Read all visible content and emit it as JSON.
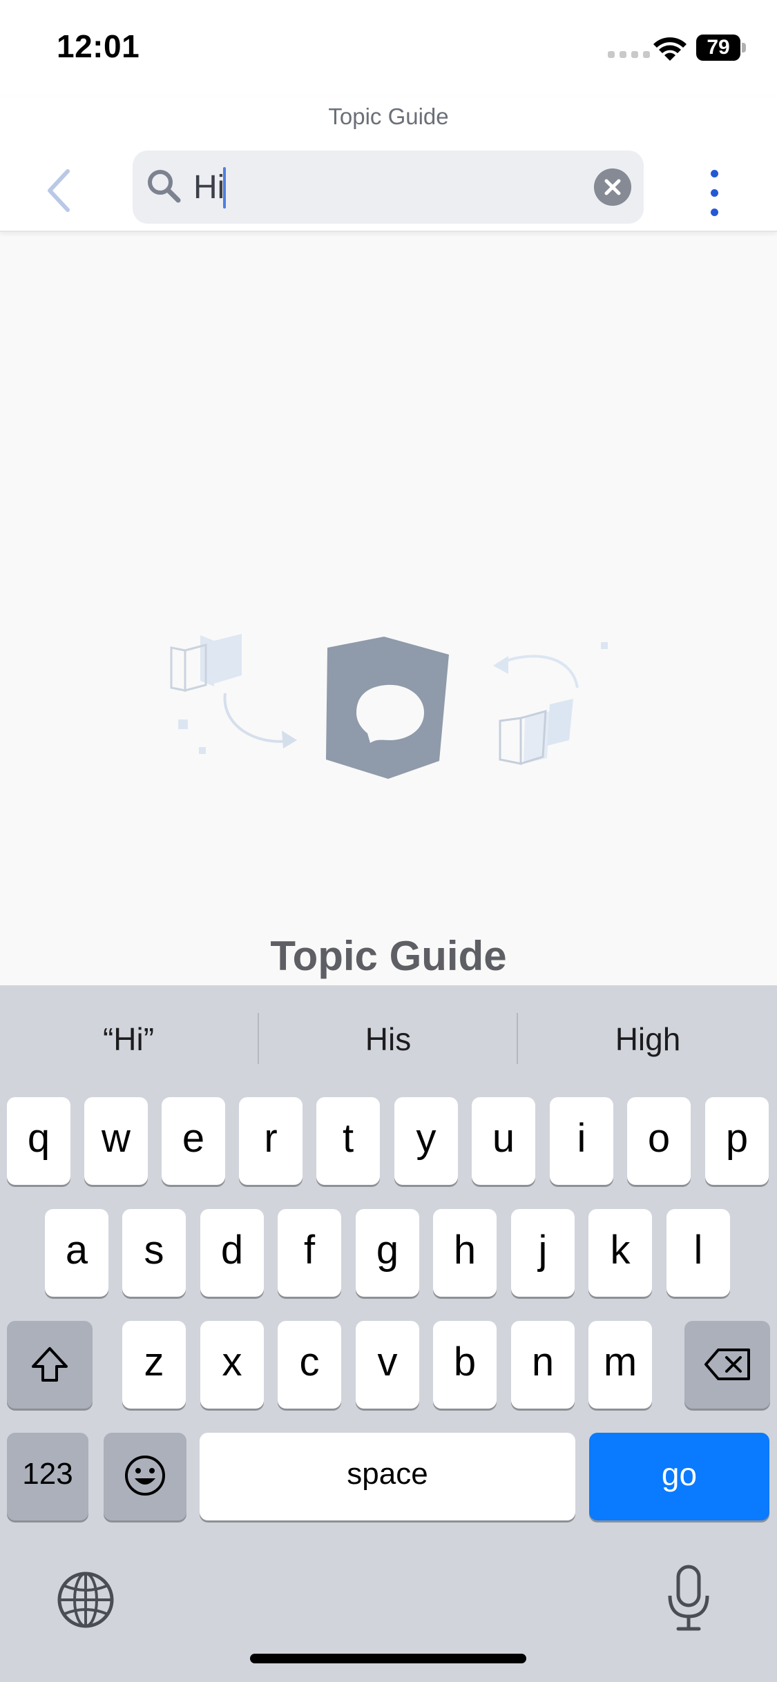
{
  "status_bar": {
    "time": "12:01",
    "battery": "79"
  },
  "header": {
    "title": "Topic Guide"
  },
  "search": {
    "value": "Hi",
    "placeholder": ""
  },
  "empty_state": {
    "title": "Topic Guide"
  },
  "keyboard": {
    "suggestions": [
      "“Hi”",
      "His",
      "High"
    ],
    "row1": [
      "q",
      "w",
      "e",
      "r",
      "t",
      "y",
      "u",
      "i",
      "o",
      "p"
    ],
    "row2": [
      "a",
      "s",
      "d",
      "f",
      "g",
      "h",
      "j",
      "k",
      "l"
    ],
    "row3": [
      "z",
      "x",
      "c",
      "v",
      "b",
      "n",
      "m"
    ],
    "numbers_label": "123",
    "space_label": "space",
    "go_label": "go"
  },
  "colors": {
    "accent": "#2459d6",
    "go_key": "#0a7aff",
    "keyboard_bg": "#d1d4db"
  },
  "icons": [
    "back-chevron-icon",
    "search-icon",
    "clear-icon",
    "more-vertical-icon",
    "shift-icon",
    "backspace-icon",
    "emoji-icon",
    "globe-icon",
    "microphone-icon"
  ]
}
